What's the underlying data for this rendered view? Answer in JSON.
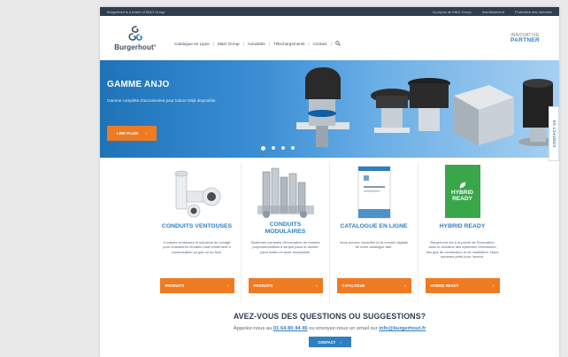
{
  "topbar": {
    "brand_note": "Burgerhout is a brand of M&G Group",
    "links": [
      "A propos de M&G Group",
      "Avertissement",
      "Protection des données"
    ]
  },
  "header": {
    "logo_text": "Burgerhout",
    "logo_reg": "®",
    "nav": [
      "Catalogue en Ligne",
      "M&G Group",
      "Actualités",
      "Téléchargements",
      "Contact"
    ],
    "partner_line1": "INNOVATIVE",
    "partner_line2": "PARTNER"
  },
  "hero": {
    "title": "GAMME ANJO",
    "subtitle": "Gamme complète d'accessoires pour toiture Déjà disponible.",
    "button_label": "LIRE PLUS!",
    "button_arrow": "›",
    "slide_count": 4,
    "active_slide": 1
  },
  "contact_tab": {
    "label": "CONTACT US"
  },
  "cards": [
    {
      "title": "CONDUITS VENTOUSES",
      "description": "Conduits ventouses et solutions de cuvage pour chaudières murales haut rendement à condensation au gaz ou au fioul.",
      "button_label": "PRODUITS",
      "button_arrow": "›"
    },
    {
      "title": "CONDUITS MODULAIRES",
      "description": "Systèmes complets d'évacuation de fumées polycombustibles à simple paroi et double paroi isolés en acier inoxydable.",
      "button_label": "PRODUITS",
      "button_arrow": "›"
    },
    {
      "title": "CATALOGUE EN LIGNE",
      "description": "Vous pouvez consulter ici la version digitale de notre catalogue tarif.",
      "button_label": "CATALOGUE",
      "button_arrow": "›"
    },
    {
      "title": "HYBRID READY",
      "description": "Burgerhout est à la pointe de l'innovation dans le domaine des systèmes d'extraction des gaz de combustion et de ventilation. Nous sommes prêts pour l'avenir.",
      "button_label": "HYBRID READY",
      "button_arrow": "›",
      "badge_line1": "HYBRID",
      "badge_line2": "READY"
    }
  ],
  "faq": {
    "title": "AVEZ-VOUS DES QUESTIONS OU SUGGESTIONS?",
    "line_prefix": "Appelez-nous au",
    "phone": "01 64 80 44 45",
    "line_mid": "ou envoyez-nous un email sur",
    "email": "info@burgerhout.fr",
    "button_label": "CONTACT",
    "button_arrow": "›"
  },
  "colors": {
    "accent_orange": "#ee7a21",
    "brand_blue": "#2f7fc1",
    "topbar_dark": "#2d3e4f",
    "hybrid_green": "#3aa64a"
  }
}
